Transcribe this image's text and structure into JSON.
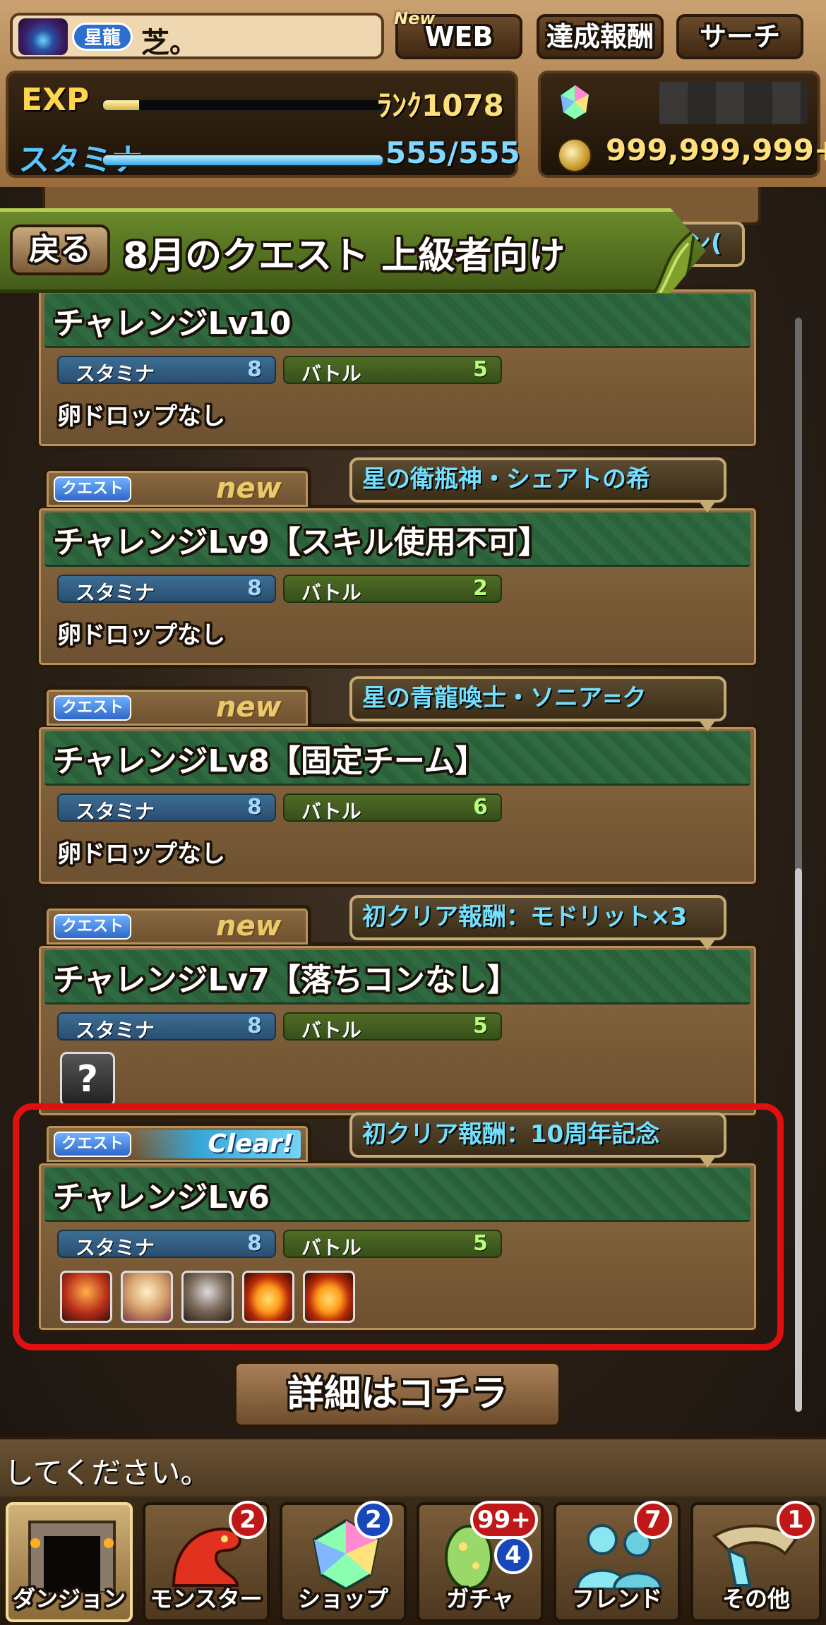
{
  "header": {
    "title_badge": "星龍",
    "player_name": "芝。",
    "new_tag": "New",
    "web_label": "WEB",
    "achievement_label": "達成報酬",
    "search_label": "サーチ",
    "exp_label": "EXP",
    "exp_progress": 0.13,
    "rank_text": "ﾗﾝｸ1078",
    "stamina_label": "スタミナ",
    "stamina_progress": 1.0,
    "stamina_text": "555/555",
    "money_text": "999,999,999+"
  },
  "quest_header": {
    "back_label": "戻る",
    "title": "8月のクエスト 上級者向け"
  },
  "labels": {
    "quest_badge": "クエスト",
    "new_text": "new",
    "clear_text": "Clear!",
    "stamina": "スタミナ",
    "battle": "バトル",
    "unknown_drop": "?"
  },
  "quests": [
    {
      "name": "チャレンジLv10",
      "bubble": "ン(",
      "stamina": "8",
      "battle": "5",
      "drop": "卵ドロップなし"
    },
    {
      "name": "チャレンジLv9【スキル使用不可】",
      "bubble": "星の衛瓶神・シェアトの希",
      "stamina": "8",
      "battle": "2",
      "drop": "卵ドロップなし"
    },
    {
      "name": "チャレンジLv8【固定チーム】",
      "bubble": "星の青龍喚士・ソニア=ク",
      "stamina": "8",
      "battle": "6",
      "drop": "卵ドロップなし"
    },
    {
      "name": "チャレンジLv7【落ちコンなし】",
      "bubble": "初クリア報酬：モドリット×3",
      "stamina": "8",
      "battle": "5"
    },
    {
      "name": "チャレンジLv6",
      "bubble": "初クリア報酬：10周年記念",
      "stamina": "8",
      "battle": "5",
      "reward_icons": [
        "monster-icon-red-warrior",
        "monster-icon-lion-girl",
        "monster-icon-dragon",
        "monster-egg-icon",
        "monster-egg-icon"
      ]
    }
  ],
  "details_button": "詳細はコチラ",
  "message": "してください。",
  "nav": [
    {
      "label": "ダンジョン",
      "icon": "dungeon-icon",
      "badge": ""
    },
    {
      "label": "モンスター",
      "icon": "monster-icon",
      "badge": "2"
    },
    {
      "label": "ショップ",
      "icon": "shop-icon",
      "badge": "2"
    },
    {
      "label": "ガチャ",
      "icon": "gacha-icon",
      "badge": "99+",
      "badge2": "4"
    },
    {
      "label": "フレンド",
      "icon": "friend-icon",
      "badge": "7"
    },
    {
      "label": "その他",
      "icon": "other-icon",
      "badge": "1"
    }
  ],
  "colors": {
    "highlight": "#e01010",
    "quest_bar": "#5a7a22",
    "card_name_bar": "#2f6a41"
  }
}
